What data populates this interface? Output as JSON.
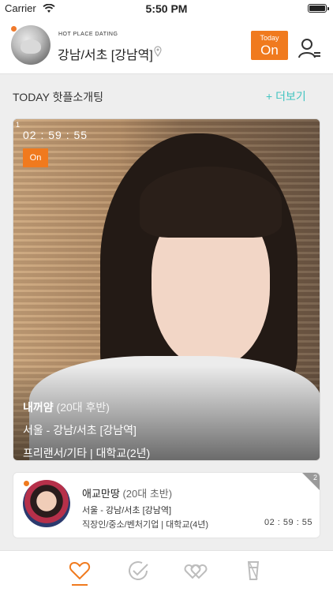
{
  "status_bar": {
    "carrier": "Carrier",
    "time": "5:50 PM"
  },
  "header": {
    "app_label": "HOT PLACE DATING",
    "region": "강남/서초 [강남역]",
    "today_label": "Today",
    "today_state": "On"
  },
  "section": {
    "title": "TODAY 핫플소개팅",
    "more_label": "+ 더보기"
  },
  "featured": {
    "index": "1",
    "timer": "02 : 59 : 55",
    "badge": "On",
    "name": "내꺼얌",
    "age": "(20대 후반)",
    "location": "서울 - 강남/서초 [강남역]",
    "job": "프리랜서/기타 | 대학교(2년)"
  },
  "list": [
    {
      "index": "2",
      "name": "애교만땅",
      "age": "(20대 초반)",
      "location": "서울 - 강남/서초 [강남역]",
      "job": "직장인/중소/벤처기업 | 대학교(4년)",
      "timer": "02 : 59 : 55"
    }
  ],
  "tabs": [
    {
      "icon": "heart-icon",
      "active": true
    },
    {
      "icon": "check-circle-icon",
      "active": false
    },
    {
      "icon": "double-heart-icon",
      "active": false
    },
    {
      "icon": "cup-icon",
      "active": false
    }
  ],
  "colors": {
    "accent": "#f07a1e",
    "link": "#41c4c0",
    "inactive": "#bdbdbd"
  }
}
